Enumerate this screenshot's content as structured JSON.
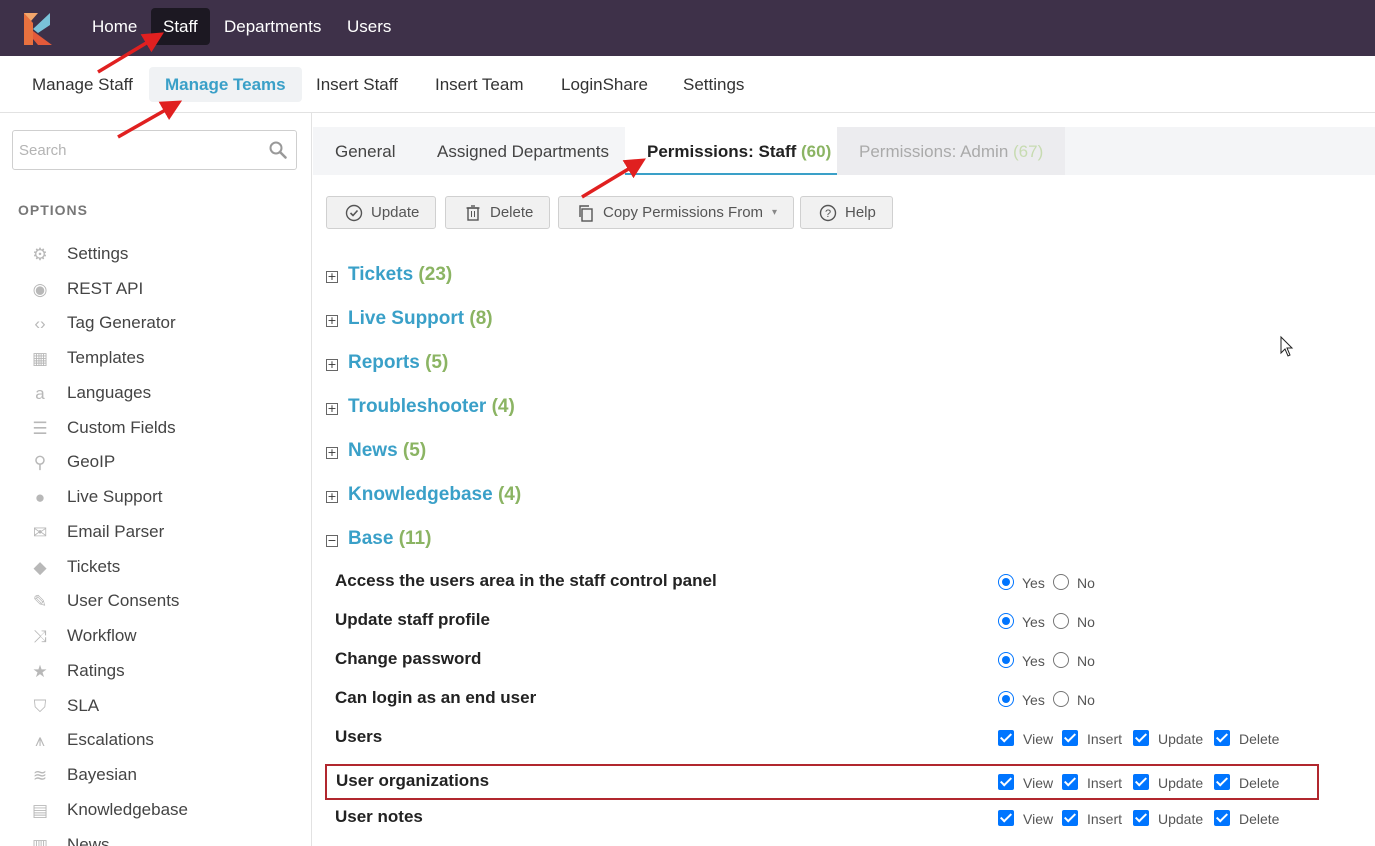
{
  "topnav": {
    "home": "Home",
    "staff": "Staff",
    "departments": "Departments",
    "users": "Users"
  },
  "subnav": {
    "manage_staff": "Manage Staff",
    "manage_teams": "Manage Teams",
    "insert_staff": "Insert Staff",
    "insert_team": "Insert Team",
    "loginshare": "LoginShare",
    "settings": "Settings"
  },
  "sidebar": {
    "search_placeholder": "Search",
    "heading": "OPTIONS",
    "items": [
      {
        "label": "Settings",
        "icon": "gear-icon"
      },
      {
        "label": "REST API",
        "icon": "broadcast-icon"
      },
      {
        "label": "Tag Generator",
        "icon": "code-icon"
      },
      {
        "label": "Templates",
        "icon": "template-icon"
      },
      {
        "label": "Languages",
        "icon": "letter-a-icon"
      },
      {
        "label": "Custom Fields",
        "icon": "fields-icon"
      },
      {
        "label": "GeoIP",
        "icon": "map-pin-icon"
      },
      {
        "label": "Live Support",
        "icon": "chat-icon"
      },
      {
        "label": "Email Parser",
        "icon": "envelope-icon"
      },
      {
        "label": "Tickets",
        "icon": "ticket-icon"
      },
      {
        "label": "User Consents",
        "icon": "wrench-icon"
      },
      {
        "label": "Workflow",
        "icon": "shuffle-icon"
      },
      {
        "label": "Ratings",
        "icon": "star-icon"
      },
      {
        "label": "SLA",
        "icon": "shield-icon"
      },
      {
        "label": "Escalations",
        "icon": "escalation-icon"
      },
      {
        "label": "Bayesian",
        "icon": "layers-icon"
      },
      {
        "label": "Knowledgebase",
        "icon": "book-icon"
      },
      {
        "label": "News",
        "icon": "news-icon"
      }
    ]
  },
  "tabs": {
    "general": "General",
    "assigned_departments": "Assigned Departments",
    "perm_staff": "Permissions: Staff",
    "perm_staff_count": "(60)",
    "perm_admin": "Permissions: Admin",
    "perm_admin_count": "(67)"
  },
  "toolbar": {
    "update": "Update",
    "delete": "Delete",
    "copy": "Copy Permissions From",
    "help": "Help"
  },
  "sections": [
    {
      "title": "Tickets",
      "count": "(23)",
      "expanded": false
    },
    {
      "title": "Live Support",
      "count": "(8)",
      "expanded": false
    },
    {
      "title": "Reports",
      "count": "(5)",
      "expanded": false
    },
    {
      "title": "Troubleshooter",
      "count": "(4)",
      "expanded": false
    },
    {
      "title": "News",
      "count": "(5)",
      "expanded": false
    },
    {
      "title": "Knowledgebase",
      "count": "(4)",
      "expanded": false
    },
    {
      "title": "Base",
      "count": "(11)",
      "expanded": true
    }
  ],
  "toggle_glyph": {
    "collapsed": "+",
    "expanded": "−"
  },
  "options": {
    "yes": "Yes",
    "no": "No",
    "view": "View",
    "insert": "Insert",
    "update": "Update",
    "delete": "Delete"
  },
  "base_permissions": [
    {
      "label": "Access the users area in the staff control panel",
      "type": "radio",
      "value": "Yes"
    },
    {
      "label": "Update staff profile",
      "type": "radio",
      "value": "Yes"
    },
    {
      "label": "Change password",
      "type": "radio",
      "value": "Yes"
    },
    {
      "label": "Can login as an end user",
      "type": "radio",
      "value": "Yes"
    },
    {
      "label": "Users",
      "type": "checkbox",
      "view": true,
      "insert": true,
      "update": true,
      "delete": true
    },
    {
      "label": "User organizations",
      "type": "checkbox",
      "view": true,
      "insert": true,
      "update": true,
      "delete": true,
      "highlighted": true
    },
    {
      "label": "User notes",
      "type": "checkbox",
      "view": true,
      "insert": true,
      "update": true,
      "delete": true
    }
  ],
  "colors": {
    "topbar": "#3e3149",
    "accent": "#3aa0c8",
    "count_green": "#8bb463",
    "annotation_arrow": "#e02020",
    "highlight_box": "#b1272e"
  }
}
